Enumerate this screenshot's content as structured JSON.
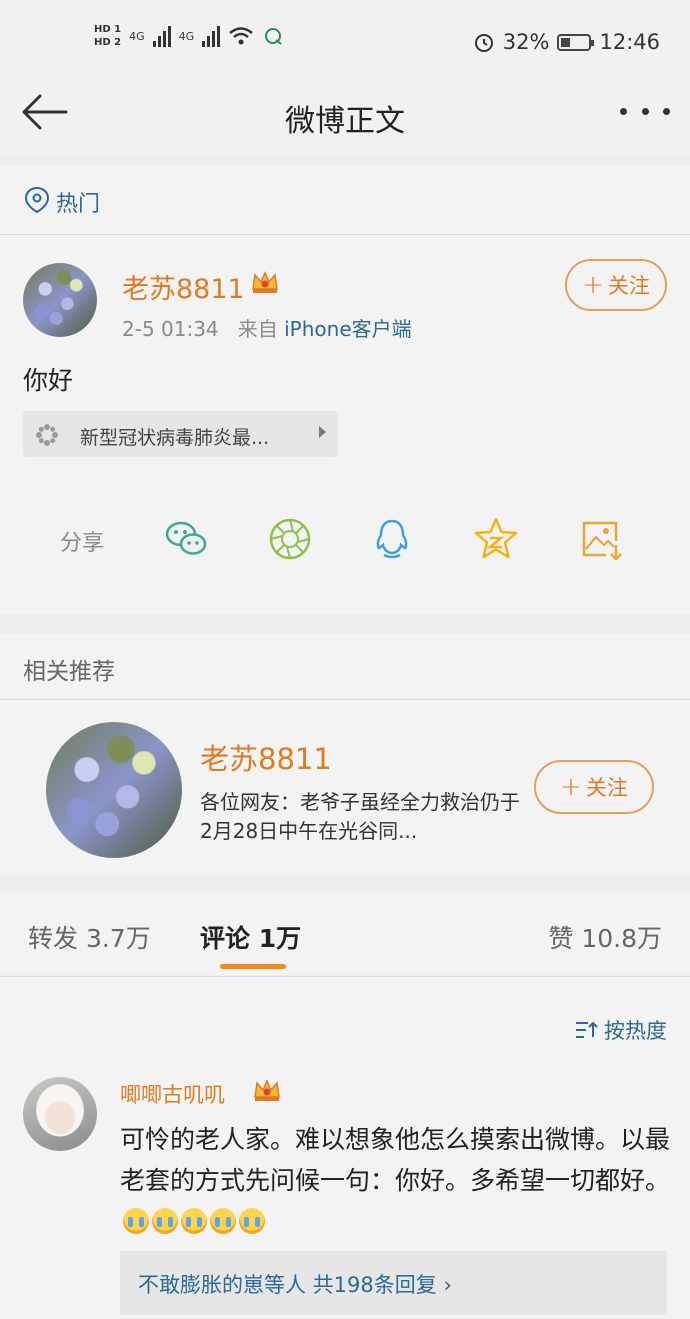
{
  "status_bar": {
    "sim1": "HD 1",
    "sim2": "HD 2",
    "net1": "4G",
    "net2": "4G",
    "battery_percent": "32%",
    "time": "12:46"
  },
  "nav": {
    "title": "微博正文"
  },
  "hot": {
    "label": "热门"
  },
  "post": {
    "username": "老苏8811",
    "time": "2-5 01:34",
    "source_prefix": "来自",
    "source": "iPhone客户端",
    "follow_label": "关注",
    "body": "你好",
    "topic": "新型冠状病毒肺炎最...",
    "share_label": "分享",
    "share_targets": [
      "wechat-icon",
      "moments-icon",
      "qq-icon",
      "qzone-icon",
      "save-image-icon"
    ]
  },
  "recommend": {
    "title": "相关推荐",
    "username": "老苏8811",
    "desc": "各位网友：老爷子虽经全力救治仍于2月28日中午在光谷同...",
    "follow_label": "关注"
  },
  "tabs": {
    "repost": "转发 3.7万",
    "comments": "评论 1万",
    "likes": "赞 10.8万"
  },
  "comments": {
    "sort_label": "按热度",
    "items": [
      {
        "username": "唧唧古叽叽",
        "text": "可怜的老人家。难以想象他怎么摸索出微博。以最老套的方式先问候一句：你好。多希望一切都好。",
        "replies": "不敢膨胀的崽等人  共198条回复"
      }
    ]
  },
  "colors": {
    "accent": "#e07b24",
    "link": "#2b6a94",
    "tab_indicator": "#f08a1c"
  }
}
